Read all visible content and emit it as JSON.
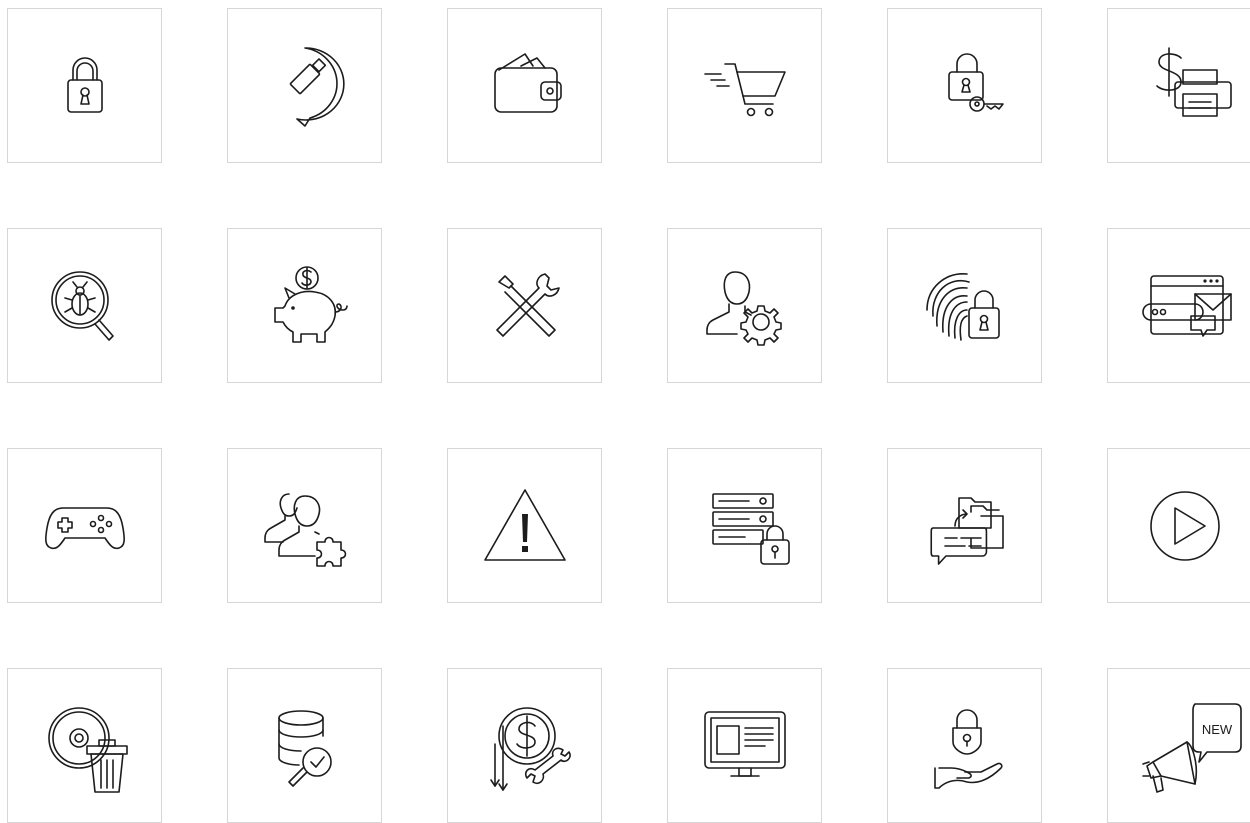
{
  "icons": [
    {
      "name": "padlock-icon"
    },
    {
      "name": "usb-chat-icon"
    },
    {
      "name": "wallet-icon"
    },
    {
      "name": "shopping-cart-icon"
    },
    {
      "name": "lock-key-icon"
    },
    {
      "name": "dollar-printer-icon"
    },
    {
      "name": "bug-search-icon"
    },
    {
      "name": "piggy-bank-icon"
    },
    {
      "name": "tools-icon"
    },
    {
      "name": "user-settings-icon"
    },
    {
      "name": "fingerprint-lock-icon"
    },
    {
      "name": "browser-mail-icon"
    },
    {
      "name": "gamepad-icon"
    },
    {
      "name": "users-puzzle-icon"
    },
    {
      "name": "warning-icon"
    },
    {
      "name": "server-lock-icon"
    },
    {
      "name": "folders-chat-icon"
    },
    {
      "name": "play-icon"
    },
    {
      "name": "disc-trash-icon"
    },
    {
      "name": "database-search-icon"
    },
    {
      "name": "dollar-wrench-icon"
    },
    {
      "name": "monitor-icon"
    },
    {
      "name": "hand-lock-icon"
    },
    {
      "name": "megaphone-new-icon",
      "badge": "NEW"
    }
  ],
  "colors": {
    "stroke": "#1c1c1c",
    "tile_border": "#d6d6d6",
    "background": "#ffffff"
  }
}
